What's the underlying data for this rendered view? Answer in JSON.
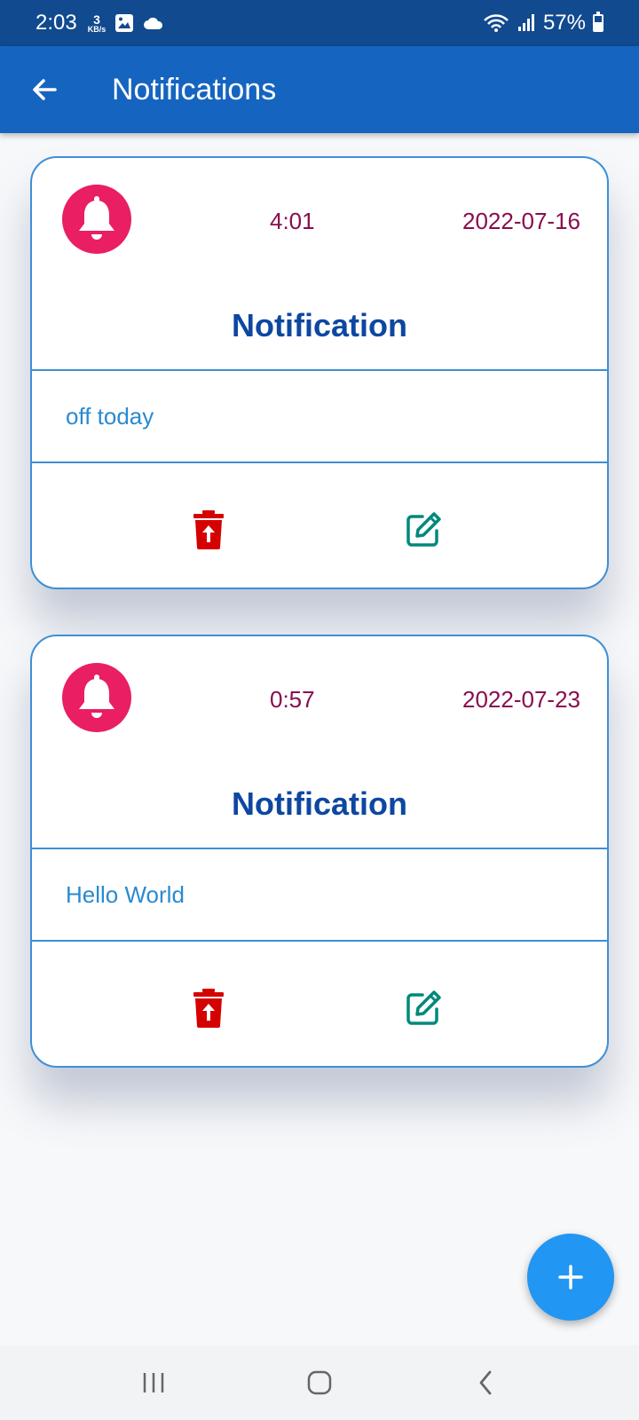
{
  "status_bar": {
    "time": "2:03",
    "speed_value": "3",
    "speed_unit": "KB/s",
    "battery_percent": "57%",
    "battery_level": 0.57,
    "icons": [
      "gallery-icon",
      "cloud-icon",
      "wifi-icon",
      "signal-icon",
      "battery-icon"
    ]
  },
  "app_bar": {
    "title": "Notifications",
    "back_icon": "arrow-left-icon"
  },
  "notifications": [
    {
      "time": "4:01",
      "date": "2022-07-16",
      "title": "Notification",
      "message": "off today"
    },
    {
      "time": "0:57",
      "date": "2022-07-23",
      "title": "Notification",
      "message": "Hello World"
    }
  ],
  "icons": {
    "bell": "bell-icon",
    "delete": "trash-restore-icon",
    "edit": "edit-icon",
    "add": "plus-icon"
  },
  "colors": {
    "status_bar": "#114a8f",
    "app_bar": "#1565c0",
    "card_border": "#3d8fd6",
    "bell_bg": "#e91e63",
    "time_date_text": "#880e4f",
    "title_text": "#0d47a1",
    "message_text": "#2a8ad0",
    "delete_icon": "#d50000",
    "edit_icon": "#00897b",
    "fab": "#2196f3"
  },
  "nav_bar": {
    "buttons": [
      "recents-icon",
      "home-icon",
      "back-icon"
    ]
  }
}
